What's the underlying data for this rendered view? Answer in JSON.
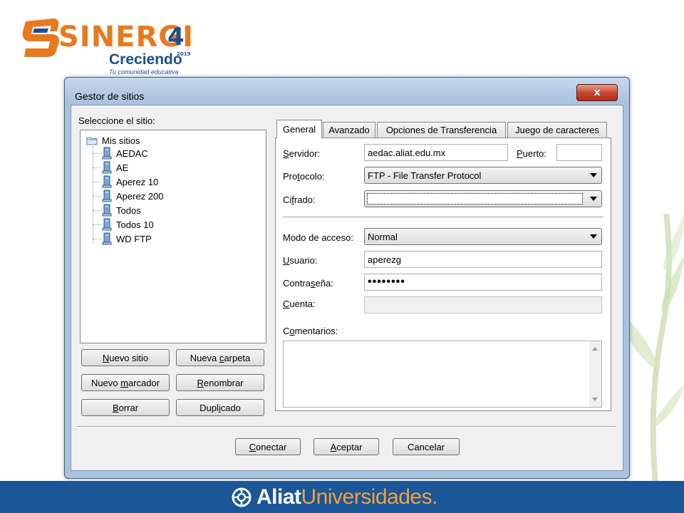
{
  "slide": {
    "logo": {
      "word": "SINERGI",
      "number": "4",
      "year": "2019",
      "sub": "Creciendo",
      "tagline": "Tu comunidad educativa",
      "colors": {
        "orange": "#e87a1e",
        "blue": "#1d4f8e"
      }
    },
    "footer": {
      "brand_a": "Aliat",
      "brand_b": "Universidades.",
      "emblem_icon": "aliat-emblem-icon",
      "bar_color": "#1a5698"
    }
  },
  "window": {
    "title": "Gestor de sitios",
    "close_label": "x",
    "site_label": "Seleccione el sitio:",
    "tree": {
      "root": "Mis sitios",
      "items": [
        "AEDAC",
        "AE",
        "Aperez 10",
        "Aperez 200",
        "Todos",
        "Todos 10",
        "WD FTP"
      ]
    },
    "buttons": {
      "new_site": {
        "u": "N",
        "rest": "uevo sitio"
      },
      "new_folder": {
        "pre": "Nueva ",
        "u": "c",
        "rest": "arpeta"
      },
      "new_bookmark": {
        "pre": "Nuevo ",
        "u": "m",
        "rest": "arcador"
      },
      "rename": {
        "u": "R",
        "rest": "enombrar"
      },
      "delete": {
        "u": "B",
        "rest": "orrar"
      },
      "duplicate": {
        "pre": "Dupl",
        "u": "i",
        "rest": "cado"
      },
      "connect": {
        "u": "C",
        "rest": "onectar"
      },
      "accept": {
        "u": "A",
        "rest": "ceptar"
      },
      "cancel": "Cancelar"
    },
    "tabs": [
      "General",
      "Avanzado",
      "Opciones de Transferencia",
      "Juego de caracteres"
    ],
    "active_tab": "General",
    "form": {
      "server": {
        "u": "S",
        "rest": "ervidor:",
        "value": "aedac.aliat.edu.mx"
      },
      "port": {
        "u": "P",
        "rest": "uerto:",
        "value": ""
      },
      "protocol": {
        "pre": "Pro",
        "u": "t",
        "rest": "ocolo:",
        "value": "FTP - File Transfer Protocol"
      },
      "encryption": {
        "pre": "Ci",
        "u": "f",
        "rest": "rado:",
        "value": ""
      },
      "access_mode": {
        "pre": "Modo de acceso:",
        "value": "Normal"
      },
      "user": {
        "u": "U",
        "rest": "suario:",
        "value": "aperezg"
      },
      "password": {
        "pre": "Contra",
        "u": "s",
        "rest": "eña:",
        "value": "••••••••"
      },
      "account": {
        "u": "C",
        "rest": "uenta:",
        "value": ""
      },
      "comments": {
        "pre": "C",
        "u": "o",
        "rest": "mentarios:",
        "value": ""
      }
    }
  }
}
